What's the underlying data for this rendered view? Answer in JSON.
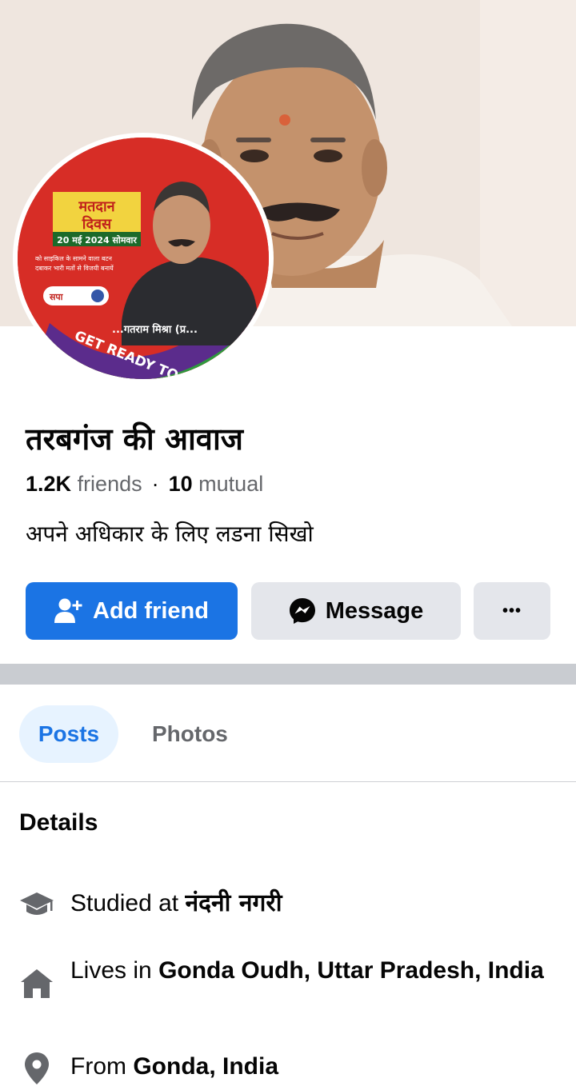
{
  "cover": {
    "avatar_text": {
      "line1": "मतदान",
      "line2": "दिवस",
      "date": "20 मई 2024 सोमवार",
      "slogan1": "को साइकिल के सामने वाला बटन",
      "slogan2": "दबाकर भारी मतों से विजयी बनायें",
      "party": "सपा",
      "candidate": "...गतराम मिश्रा (प्र...",
      "banner": "GET READY TO VOTE!"
    }
  },
  "profile": {
    "name": "तरबगंज की आवाज",
    "friends_count": "1.2K",
    "friends_label": "friends",
    "mutual_count": "10",
    "mutual_label": "mutual",
    "bio": "अपने अधिकार के लिए लडना सिखो"
  },
  "actions": {
    "add_friend": "Add friend",
    "message": "Message",
    "more": "•••"
  },
  "tabs": {
    "posts": "Posts",
    "photos": "Photos"
  },
  "details": {
    "title": "Details",
    "studied_prefix": "Studied at",
    "studied_value": "नंदनी नगरी",
    "lives_prefix": "Lives in",
    "lives_value": "Gonda Oudh, Uttar Pradesh, India",
    "from_prefix": "From",
    "from_value": "Gonda, India"
  },
  "colors": {
    "primary": "#1b74e4",
    "secondary_button": "#e4e6eb",
    "muted_text": "#65676b",
    "tab_active_bg": "#e7f3ff"
  }
}
